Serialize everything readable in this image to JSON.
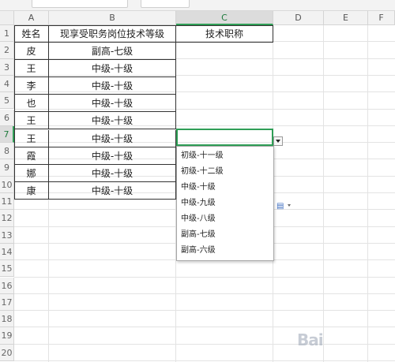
{
  "columns": [
    "A",
    "B",
    "C",
    "D",
    "E",
    "F"
  ],
  "rows": [
    "1",
    "2",
    "3",
    "4",
    "5",
    "6",
    "7",
    "8",
    "9",
    "10",
    "11",
    "12",
    "13",
    "14",
    "15",
    "16",
    "17",
    "18",
    "19",
    "20"
  ],
  "headers": {
    "a1": "姓名",
    "b1": "现享受职务岗位技术等级",
    "c1": "技术职称"
  },
  "table": [
    {
      "name": "皮",
      "level": "副高-七级"
    },
    {
      "name": "王",
      "level": "中级-十级"
    },
    {
      "name": "李",
      "level": "中级-十级"
    },
    {
      "name": "也",
      "level": "中级-十级"
    },
    {
      "name": "王",
      "level": "中级-十级"
    },
    {
      "name": "王",
      "level": "中级-十级"
    },
    {
      "name": "霞",
      "level": "中级-十级"
    },
    {
      "name": "娜",
      "level": "中级-十级"
    },
    {
      "name": "康",
      "level": "中级-十级"
    }
  ],
  "dropdown": {
    "options": [
      "初级-十一级",
      "初级-十二级",
      "中级-十级",
      "中级-九级",
      "中级-八级",
      "副高-七级",
      "副高-六级"
    ]
  },
  "active_cell": {
    "column": "C",
    "row": "7"
  },
  "paste_options_icon": "paste-options-icon",
  "watermark_text": "Bai"
}
